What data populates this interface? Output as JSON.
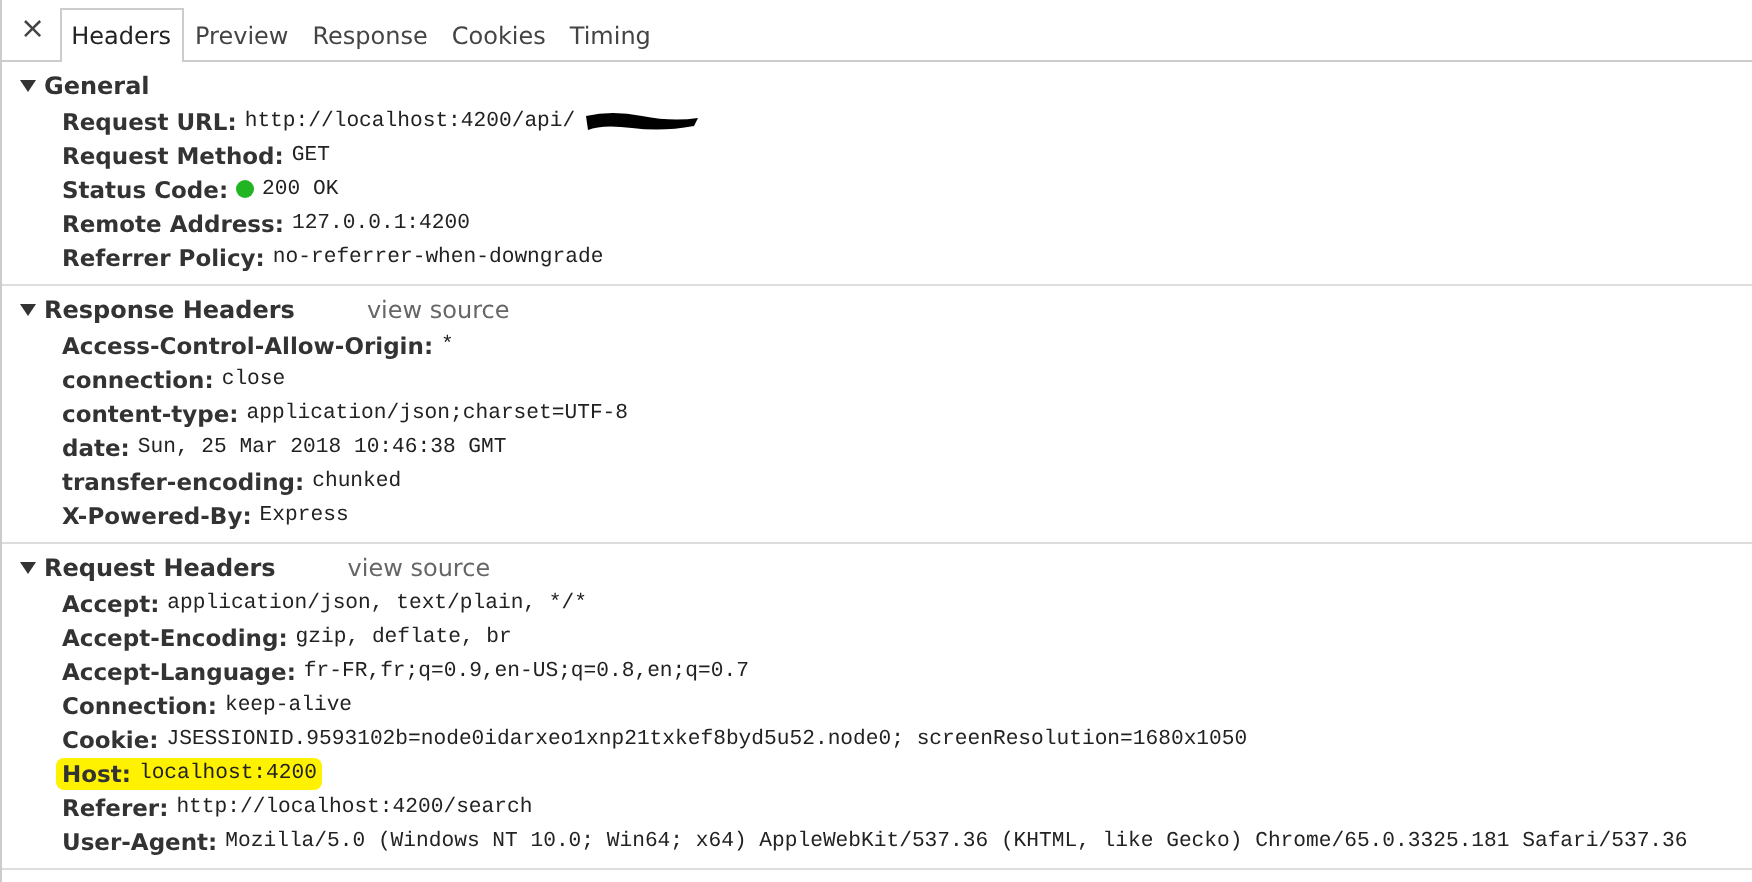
{
  "close_button": "×",
  "tabs": [
    {
      "label": "Headers",
      "selected": true
    },
    {
      "label": "Preview",
      "selected": false
    },
    {
      "label": "Response",
      "selected": false
    },
    {
      "label": "Cookies",
      "selected": false
    },
    {
      "label": "Timing",
      "selected": false
    }
  ],
  "sections": [
    {
      "title": "General",
      "expanded": true,
      "rows": [
        {
          "kind": "redacted",
          "name": "Request URL:",
          "value": "http://localhost:4200/api/",
          "highlighted": false
        },
        {
          "kind": "text",
          "name": "Request Method:",
          "value": "GET",
          "highlighted": false
        },
        {
          "kind": "status",
          "name": "Status Code:",
          "value": "200 OK",
          "color": "#22b422",
          "highlighted": false
        },
        {
          "kind": "text",
          "name": "Remote Address:",
          "value": "127.0.0.1:4200",
          "highlighted": false
        },
        {
          "kind": "text",
          "name": "Referrer Policy:",
          "value": "no-referrer-when-downgrade",
          "highlighted": false
        }
      ]
    },
    {
      "title": "Response Headers",
      "expanded": true,
      "link": "view source",
      "rows": [
        {
          "kind": "text",
          "name": "Access-Control-Allow-Origin:",
          "value": "*",
          "highlighted": false
        },
        {
          "kind": "text",
          "name": "connection:",
          "value": "close",
          "highlighted": false
        },
        {
          "kind": "text",
          "name": "content-type:",
          "value": "application/json;charset=UTF-8",
          "highlighted": false
        },
        {
          "kind": "text",
          "name": "date:",
          "value": "Sun, 25 Mar 2018 10:46:38 GMT",
          "highlighted": false
        },
        {
          "kind": "text",
          "name": "transfer-encoding:",
          "value": "chunked",
          "highlighted": false
        },
        {
          "kind": "text",
          "name": "X-Powered-By:",
          "value": "Express",
          "highlighted": false
        }
      ]
    },
    {
      "title": "Request Headers",
      "expanded": true,
      "link": "view source",
      "rows": [
        {
          "kind": "text",
          "name": "Accept:",
          "value": "application/json, text/plain, */*",
          "highlighted": false
        },
        {
          "kind": "text",
          "name": "Accept-Encoding:",
          "value": "gzip, deflate, br",
          "highlighted": false
        },
        {
          "kind": "text",
          "name": "Accept-Language:",
          "value": "fr-FR,fr;q=0.9,en-US;q=0.8,en;q=0.7",
          "highlighted": false
        },
        {
          "kind": "text",
          "name": "Connection:",
          "value": "keep-alive",
          "highlighted": false
        },
        {
          "kind": "text",
          "name": "Cookie:",
          "value": "JSESSIONID.9593102b=node0idarxeo1xnp21txkef8byd5u52.node0; screenResolution=1680x1050",
          "highlighted": false
        },
        {
          "kind": "text",
          "name": "Host:",
          "value": "localhost:4200",
          "highlighted": true
        },
        {
          "kind": "text",
          "name": "Referer:",
          "value": "http://localhost:4200/search",
          "highlighted": false
        },
        {
          "kind": "text",
          "name": "User-Agent:",
          "value": "Mozilla/5.0 (Windows NT 10.0; Win64; x64) AppleWebKit/537.36 (KHTML, like Gecko) Chrome/65.0.3325.181 Safari/537.36",
          "highlighted": false
        }
      ]
    }
  ]
}
